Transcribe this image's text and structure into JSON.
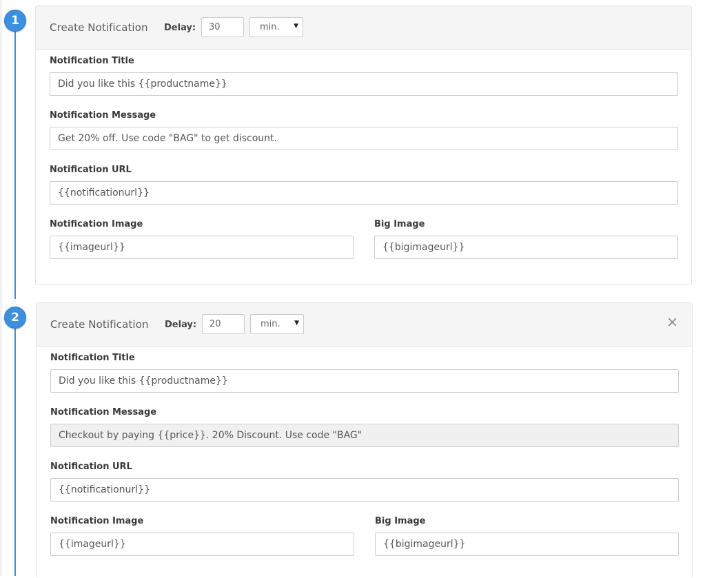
{
  "notifications": [
    {
      "step": "1",
      "header_title": "Create Notification",
      "delay_label": "Delay:",
      "delay_value": "30",
      "delay_unit": "min.",
      "fields": {
        "title_label": "Notification Title",
        "title_value": "Did you like this {{productname}}",
        "message_label": "Notification Message",
        "message_value": "Get 20% off. Use code \"BAG\" to get discount.",
        "url_label": "Notification URL",
        "url_value": "{{notificationurl}}",
        "image_label": "Notification Image",
        "image_value": "{{imageurl}}",
        "big_image_label": "Big Image",
        "big_image_value": "{{bigimageurl}}"
      }
    },
    {
      "step": "2",
      "header_title": "Create Notification",
      "delay_label": "Delay:",
      "delay_value": "20",
      "delay_unit": "min.",
      "close_symbol": "×",
      "fields": {
        "title_label": "Notification Title",
        "title_value": "Did you like this {{productname}}",
        "message_label": "Notification Message",
        "message_value": "Checkout by paying {{price}}. 20% Discount. Use code \"BAG\"",
        "url_label": "Notification URL",
        "url_value": "{{notificationurl}}",
        "image_label": "Notification Image",
        "image_value": "{{imageurl}}",
        "big_image_label": "Big Image",
        "big_image_value": "{{bigimageurl}}"
      }
    }
  ],
  "colors": {
    "accent": "#3d8fe0",
    "header_bg": "#f5f5f5",
    "border": "#e1e3e6"
  },
  "icons": {
    "dropdown": "caret-down-icon",
    "close": "close-icon"
  }
}
